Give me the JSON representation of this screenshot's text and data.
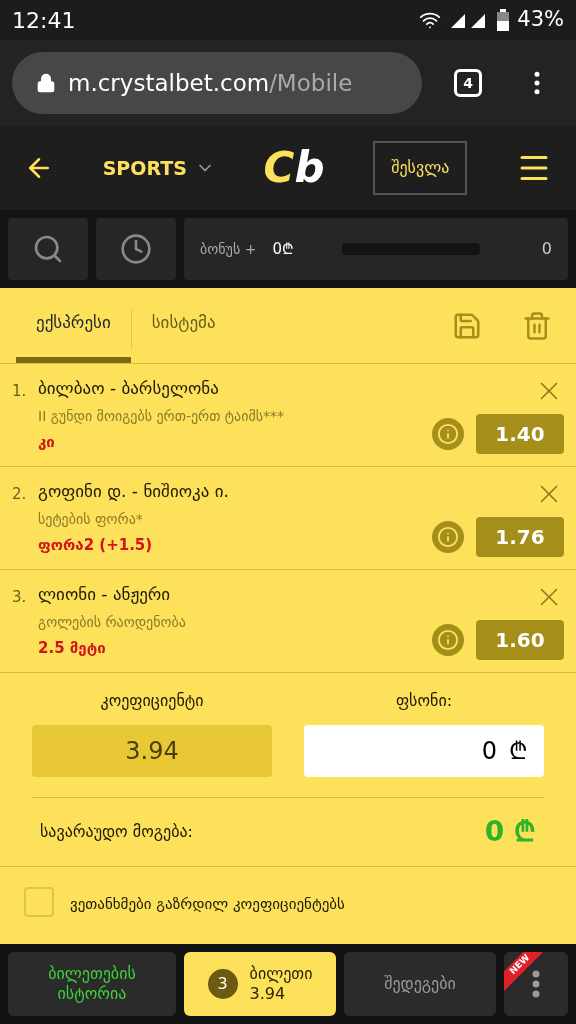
{
  "status_bar": {
    "time": "12:41",
    "battery": "43%"
  },
  "browser": {
    "url_host": "m.crystalbet.com",
    "url_path": "/Mobile",
    "tab_count": "4"
  },
  "header": {
    "section": "SPORTS",
    "logo_c": "C",
    "logo_b": "b",
    "login": "შესვლა"
  },
  "toolbar": {
    "bonus_label": "ბონუს +",
    "bonus_amount": "0₾",
    "bonus_meter": {
      "level": 0
    },
    "bonus_count": "0"
  },
  "tabs": [
    {
      "label": "ექსპრესი",
      "selected": true
    },
    {
      "label": "სისტემა",
      "selected": false
    }
  ],
  "bets": [
    {
      "number": "1.",
      "match": "ბილბაო - ბარსელონა",
      "market": "II გუნდი მოიგებს ერთ-ერთ ტაიმს***",
      "pick": "კი",
      "odds": "1.40"
    },
    {
      "number": "2.",
      "match": "გოფინი დ. - ნიშიოკა ი.",
      "market": "სეტების ფორა*",
      "pick": "ფორა2 (+1.5)",
      "odds": "1.76"
    },
    {
      "number": "3.",
      "match": "ლიონი - ანჟერი",
      "market": "გოლების რაოდენობა",
      "pick": "2.5 მეტი",
      "odds": "1.60"
    }
  ],
  "summary": {
    "odds_label": "კოეფიციენტი",
    "odds_value": "3.94",
    "stake_label": "ფსონი:",
    "stake_value": "0",
    "currency": "₾",
    "win_label": "სავარაუდო მოგება:",
    "win_value": "0 ₾"
  },
  "agree": {
    "label": "ვეთანხმები გაზრდილ კოეფიციენტებს",
    "checked": false
  },
  "bottom_nav": [
    {
      "kind": "history",
      "label": "ბილეთების ისტორია",
      "selected": false
    },
    {
      "kind": "ticket",
      "label": "ბილეთი",
      "count": "3",
      "value": "3.94",
      "selected": true
    },
    {
      "kind": "results",
      "label": "შედეგები",
      "selected": false
    },
    {
      "kind": "more",
      "badge": "NEW",
      "selected": false
    }
  ]
}
